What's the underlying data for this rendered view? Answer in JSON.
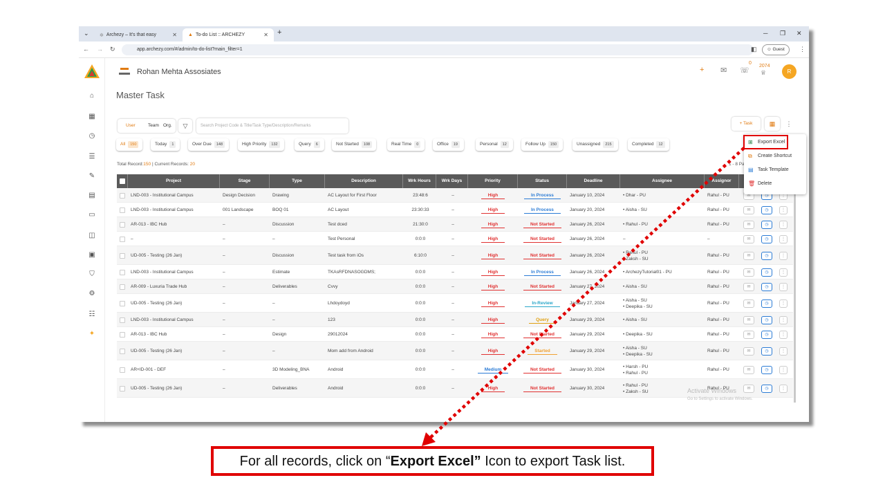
{
  "browser": {
    "tabs": [
      {
        "label": "Archezy – It's that easy"
      },
      {
        "label": "To-do List :: ARCHEZY"
      }
    ],
    "new_tab": "+",
    "url": "app.archezy.com/#/admin/to-do-list?main_filter=1",
    "guest_label": "Guest"
  },
  "brand": {
    "logo_text": "ARCHEZY"
  },
  "header": {
    "company": "Rohan Mehta Assosiates",
    "notification_count": "0",
    "points": "2074",
    "avatar_initial": "R"
  },
  "page": {
    "title": "Master Task"
  },
  "toolbar": {
    "segments": [
      "User",
      "Team",
      "Org."
    ],
    "search_placeholder": "Search Project Code & Title/Task Type/Description/Remarks",
    "task_button": "+  Task"
  },
  "filters": [
    {
      "label": "All",
      "count": "150",
      "active": true
    },
    {
      "label": "Today",
      "count": "1"
    },
    {
      "label": "Over Due",
      "count": "148"
    },
    {
      "label": "High Priority",
      "count": "132"
    },
    {
      "label": "Query",
      "count": "6"
    },
    {
      "label": "Not Started",
      "count": "108"
    },
    {
      "label": "Real Time",
      "count": "0"
    },
    {
      "label": "Office",
      "count": "19"
    },
    {
      "label": "Personal",
      "count": "12"
    },
    {
      "label": "Follow Up",
      "count": "150"
    },
    {
      "label": "Unassigned",
      "count": "215"
    },
    {
      "label": "Completed",
      "count": "12"
    }
  ],
  "totals": {
    "prefix": "Total Record:",
    "total": "150",
    "sep": " | Current Records: ",
    "current": "20"
  },
  "pagination_note": "1 - 8 Pa",
  "table": {
    "columns": [
      "Project",
      "Stage",
      "Type",
      "Description",
      "Wrk Hours",
      "Wrk Days",
      "Priority",
      "Status",
      "Deadline",
      "Assignee",
      "Assignor"
    ],
    "rows": [
      {
        "project": "LND-003 - Institutional Campus",
        "stage": "Design Decision",
        "type": "Drawing",
        "desc": "AC Layout for First Floor",
        "hours": "23:48:6",
        "days": "–",
        "priority": "High",
        "status": "In Process",
        "deadline": "January 10, 2024",
        "assignee": [
          "Dhar - PU"
        ],
        "assignor": "Rahul - PU"
      },
      {
        "project": "LND-003 - Institutional Campus",
        "stage": "001 Landscape",
        "type": "BOQ 01",
        "desc": "AC Layout",
        "hours": "23:30:33",
        "days": "–",
        "priority": "High",
        "status": "In Process",
        "deadline": "January 20, 2024",
        "assignee": [
          "Aisha - SU"
        ],
        "assignor": "Rahul - PU"
      },
      {
        "project": "AR-013 - IBC Hub",
        "stage": "–",
        "type": "Discussion",
        "desc": "Test dced",
        "hours": "21:30:0",
        "days": "–",
        "priority": "High",
        "status": "Not Started",
        "deadline": "January 26, 2024",
        "assignee": [
          "Rahul - PU"
        ],
        "assignor": "Rahul - PU"
      },
      {
        "project": "–",
        "stage": "–",
        "type": "–",
        "desc": "Test Personal",
        "hours": "0:0:0",
        "days": "–",
        "priority": "High",
        "status": "Not Started",
        "deadline": "January 26, 2024",
        "assignee": [
          "–"
        ],
        "assignor": "–"
      },
      {
        "project": "UD-005 - Testing (26 Jan)",
        "stage": "–",
        "type": "Discussion",
        "desc": "Test task from iOs",
        "hours": "6:10:0",
        "days": "–",
        "priority": "High",
        "status": "Not Started",
        "deadline": "January 26, 2024",
        "assignee": [
          "Rahul - PU",
          "Zaksh - SU"
        ],
        "assignor": "Rahul - PU"
      },
      {
        "project": "LND-003 - Institutional Campus",
        "stage": "–",
        "type": "Estimate",
        "desc": "TKAsRFDNASOGDMS;",
        "hours": "0:0:0",
        "days": "–",
        "priority": "High",
        "status": "In Process",
        "deadline": "January 26, 2024",
        "assignee": [
          "ArchezyTutorial01 - PU"
        ],
        "assignor": "Rahul - PU"
      },
      {
        "project": "AR-009 - Luxuria Trade Hub",
        "stage": "–",
        "type": "Deliverables",
        "desc": "Cvvy",
        "hours": "0:0:0",
        "days": "–",
        "priority": "High",
        "status": "Not Started",
        "deadline": "January 27, 2024",
        "assignee": [
          "Aisha - SU"
        ],
        "assignor": "Rahul - PU"
      },
      {
        "project": "UD-005 - Testing (26 Jan)",
        "stage": "–",
        "type": "–",
        "desc": "Lhdoydoyd",
        "hours": "0:0:0",
        "days": "–",
        "priority": "High",
        "status": "In-Review",
        "deadline": "January 27, 2024",
        "assignee": [
          "Aisha - SU",
          "Deepika - SU"
        ],
        "assignor": "Rahul - PU"
      },
      {
        "project": "LND-003 - Institutional Campus",
        "stage": "–",
        "type": "–",
        "desc": "123",
        "hours": "0:0:0",
        "days": "–",
        "priority": "High",
        "status": "Query",
        "deadline": "January 29, 2024",
        "assignee": [
          "Aisha - SU"
        ],
        "assignor": "Rahul - PU"
      },
      {
        "project": "AR-013 - IBC Hub",
        "stage": "–",
        "type": "Design",
        "desc": "29012024",
        "hours": "0:0:0",
        "days": "–",
        "priority": "High",
        "status": "Not Started",
        "deadline": "January 29, 2024",
        "assignee": [
          "Deepika - SU"
        ],
        "assignor": "Rahul - PU"
      },
      {
        "project": "UD-005 - Testing (26 Jan)",
        "stage": "–",
        "type": "–",
        "desc": "Mom add from Android",
        "hours": "0:0:0",
        "days": "–",
        "priority": "High",
        "status": "Started",
        "deadline": "January 29, 2024",
        "assignee": [
          "Aisha - SU",
          "Deepika - SU"
        ],
        "assignor": "Rahul - PU"
      },
      {
        "project": "AR+ID-001 - DEF",
        "stage": "–",
        "type": "3D Modeling_BNA",
        "desc": "Android",
        "hours": "0:0:0",
        "days": "–",
        "priority": "Medium",
        "status": "Not Started",
        "deadline": "January 30, 2024",
        "assignee": [
          "Harsh - PU",
          "Rahul - PU"
        ],
        "assignor": "Rahul - PU"
      },
      {
        "project": "UD-005 - Testing (26 Jan)",
        "stage": "–",
        "type": "Deliverables",
        "desc": "Android",
        "hours": "0:0:0",
        "days": "–",
        "priority": "High",
        "status": "Not Started",
        "deadline": "January 30, 2024",
        "assignee": [
          "Rahul - PU",
          "Zaksh - SU"
        ],
        "assignor": "Rahul - PU"
      }
    ]
  },
  "menu": {
    "items": [
      "Export Excel",
      "Create Shortcut",
      "Task Template",
      "Delete"
    ]
  },
  "watermark": {
    "line1": "Activate Windows",
    "line2": "Go to Settings to activate Windows."
  },
  "callout": {
    "pre": "For all records, click on “",
    "bold": "Export Excel”",
    "post": " Icon to export Task list."
  },
  "colors": {
    "accent": "#e07a10",
    "high": "#e03030",
    "in_process": "#2a7bd5",
    "not_started": "#e03030",
    "review": "#2aa6c9",
    "query": "#e0a010",
    "started": "#f0a030",
    "highlight": "#e00000"
  }
}
